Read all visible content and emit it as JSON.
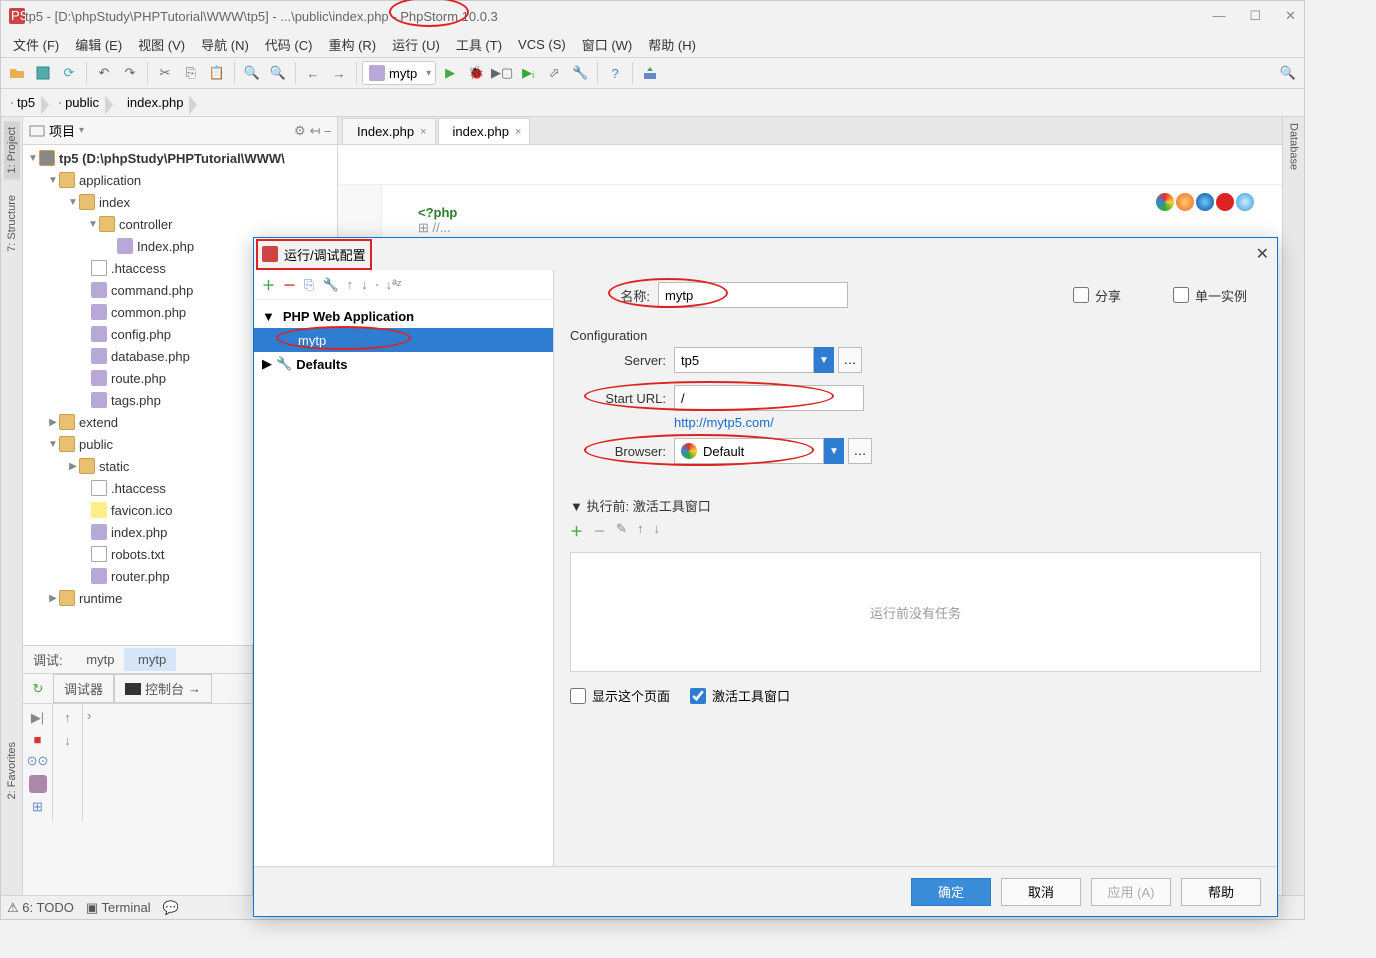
{
  "title": "tp5 - [D:\\phpStudy\\PHPTutorial\\WWW\\tp5] - ...\\public\\index.php - PhpStorm 10.0.3",
  "menu": [
    "文件 (F)",
    "编辑 (E)",
    "视图 (V)",
    "导航 (N)",
    "代码 (C)",
    "重构 (R)",
    "运行 (U)",
    "工具 (T)",
    "VCS (S)",
    "窗口 (W)",
    "帮助 (H)"
  ],
  "run_config": "mytp",
  "breadcrumb": [
    {
      "icon": "folder",
      "label": "tp5"
    },
    {
      "icon": "folder",
      "label": "public"
    },
    {
      "icon": "php",
      "label": "index.php"
    }
  ],
  "project_header": "项目",
  "project_tree": {
    "root": "tp5 (D:\\phpStudy\\PHPTutorial\\WWW\\",
    "application_label": "application",
    "index_label": "index",
    "controller_label": "controller",
    "index_php": "Index.php",
    "app_files": [
      ".htaccess",
      "command.php",
      "common.php",
      "config.php",
      "database.php",
      "route.php",
      "tags.php"
    ],
    "extend_label": "extend",
    "public_label": "public",
    "static_label": "static",
    "public_files": [
      ".htaccess",
      "favicon.ico",
      "index.php",
      "robots.txt",
      "router.php"
    ],
    "runtime_label": "runtime"
  },
  "editor_tabs": [
    {
      "name": "Index.php"
    },
    {
      "name": "index.php"
    }
  ],
  "code_tag": "<?php",
  "code_comment": "//...",
  "left_tabs": [
    "1: Project",
    "7: Structure",
    "2: Favorites"
  ],
  "right_tab": "Database",
  "debug": {
    "tab_label": "调试:",
    "mytp1": "mytp",
    "mytp2": "mytp",
    "debugger": "调试器",
    "console": "控制台"
  },
  "bottom": {
    "todo": "6: TODO",
    "terminal": "Terminal"
  },
  "dialog": {
    "title": "运行/调试配置",
    "tree": {
      "php_web_app": "PHP Web Application",
      "mytp": "mytp",
      "defaults": "Defaults"
    },
    "name_label": "名称:",
    "name_value": "mytp",
    "share_label": "分享",
    "single_label": "单一实例",
    "config_label": "Configuration",
    "server_label": "Server:",
    "server_value": "tp5",
    "starturl_label": "Start URL:",
    "starturl_value": "/",
    "url_display": "http://mytp5.com/",
    "browser_label": "Browser:",
    "browser_value": "Default",
    "before_label": "执行前: 激活工具窗口",
    "no_tasks": "运行前没有任务",
    "show_page": "显示这个页面",
    "activate_tool": "激活工具窗口",
    "ok": "确定",
    "cancel": "取消",
    "apply": "应用 (A)",
    "help": "帮助"
  }
}
